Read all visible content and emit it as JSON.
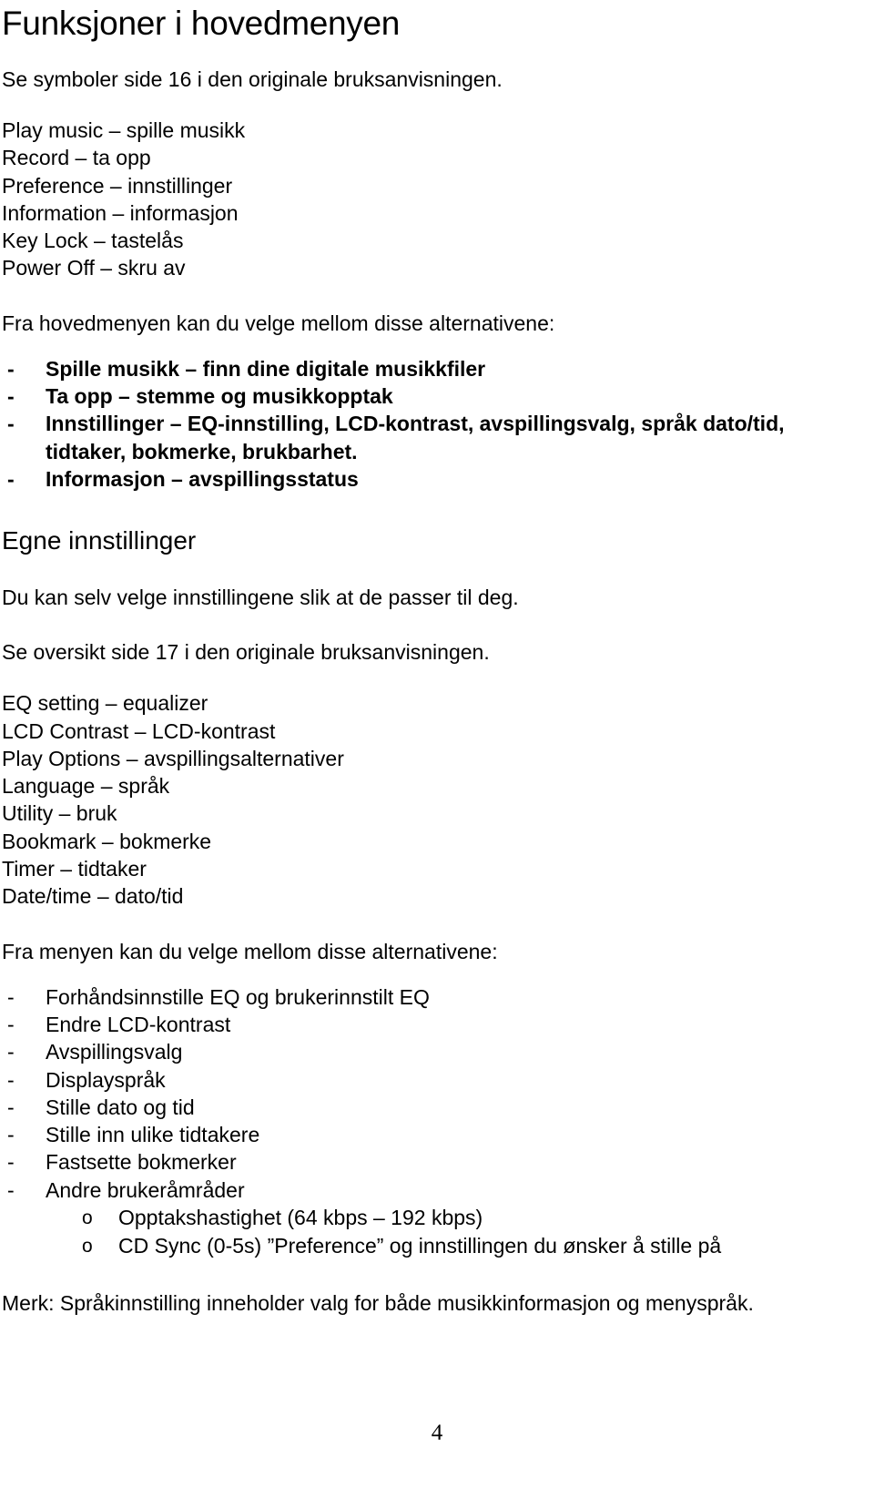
{
  "document": {
    "title": "Funksjoner i hovedmenyen",
    "subtitle": "Se symboler side 16 i den originale bruksanvisningen.",
    "main_menu_items": [
      "Play music – spille musikk",
      "Record – ta opp",
      "Preference – innstillinger",
      "Information – informasjon",
      "Key Lock – tastelås",
      "Power Off – skru av"
    ],
    "main_menu_intro": "Fra hovedmenyen kan du velge mellom disse alternativene:",
    "main_menu_bullets": [
      {
        "marker": "-",
        "text": "Spille musikk – finn dine digitale musikkfiler",
        "continuation": ""
      },
      {
        "marker": "-",
        "text": "Ta opp – stemme og musikkopptak",
        "continuation": ""
      },
      {
        "marker": "-",
        "text": "Innstillinger – EQ-innstilling, LCD-kontrast, avspillingsvalg, språk dato/tid,",
        "continuation": "tidtaker, bokmerke, brukbarhet."
      },
      {
        "marker": "-",
        "text": "Informasjon – avspillingsstatus",
        "continuation": ""
      }
    ],
    "settings_heading": "Egne innstillinger",
    "settings_intro": "Du kan selv velge innstillingene slik at de passer til deg.",
    "settings_reference": "Se oversikt side 17 i den originale bruksanvisningen.",
    "settings_items": [
      "EQ setting – equalizer",
      "LCD Contrast – LCD-kontrast",
      "Play Options – avspillingsalternativer",
      "Language – språk",
      "Utility – bruk",
      "Bookmark – bokmerke",
      "Timer – tidtaker",
      "Date/time – dato/tid"
    ],
    "menu_intro": "Fra menyen kan du velge mellom disse alternativene:",
    "menu_bullets": [
      {
        "marker": "-",
        "text": "Forhåndsinnstille EQ og brukerinnstilt EQ"
      },
      {
        "marker": "-",
        "text": "Endre LCD-kontrast"
      },
      {
        "marker": "-",
        "text": "Avspillingsvalg"
      },
      {
        "marker": "-",
        "text": "Displayspråk"
      },
      {
        "marker": "-",
        "text": "Stille dato og tid"
      },
      {
        "marker": "-",
        "text": "Stille inn ulike tidtakere"
      },
      {
        "marker": "-",
        "text": "Fastsette bokmerker"
      },
      {
        "marker": "-",
        "text": "Andre brukeråmråder"
      }
    ],
    "menu_sub_bullets": [
      {
        "marker": "o",
        "text": "Opptakshastighet (64 kbps – 192 kbps)"
      },
      {
        "marker": "o",
        "text": "CD Sync (0-5s) ”Preference” og innstillingen du ønsker å stille på"
      }
    ],
    "note": "Merk: Språkinnstilling inneholder valg for både musikkinformasjon og menyspråk.",
    "page_number": "4"
  }
}
